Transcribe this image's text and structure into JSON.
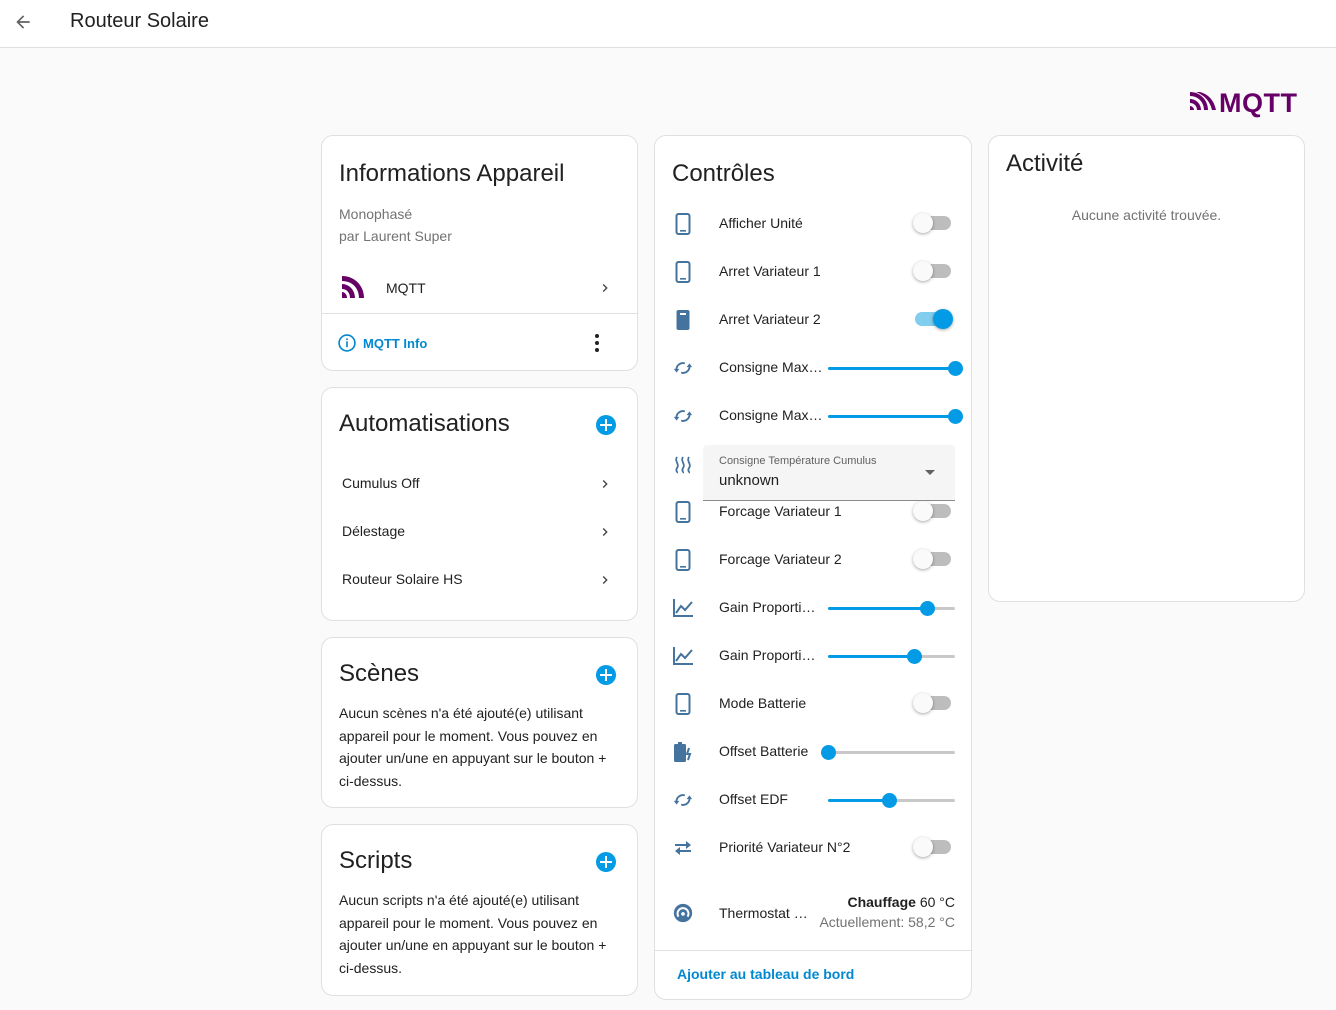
{
  "header": {
    "title": "Routeur Solaire"
  },
  "logo": {
    "text": "MQTT",
    "color": "#660066"
  },
  "device_info": {
    "title": "Informations Appareil",
    "model": "Monophasé",
    "manufacturer": "par Laurent Super",
    "integration": "MQTT",
    "info_link": "MQTT Info"
  },
  "automations": {
    "title": "Automatisations",
    "items": [
      "Cumulus Off",
      "Délestage",
      "Routeur Solaire HS"
    ]
  },
  "scenes": {
    "title": "Scènes",
    "empty_text": "Aucun scènes n'a été ajouté(e) utilisant appareil pour le moment. Vous pouvez en ajouter un/une en appuyant sur le bouton + ci-dessus."
  },
  "scripts": {
    "title": "Scripts",
    "empty_text": "Aucun scripts n'a été ajouté(e) utilisant appareil pour le moment. Vous pouvez en ajouter un/une en appuyant sur le bouton + ci-dessus."
  },
  "controls": {
    "title": "Contrôles",
    "rows": [
      {
        "label": "Afficher Unité",
        "icon": "phone-icon",
        "kind": "switch",
        "on": false
      },
      {
        "label": "Arret Variateur 1",
        "icon": "phone-icon",
        "kind": "switch",
        "on": false
      },
      {
        "label": "Arret Variateur 2",
        "icon": "phone-filled-icon",
        "kind": "switch",
        "on": true
      },
      {
        "label": "Consigne Max…",
        "icon": "rotate-icon",
        "kind": "slider",
        "value": 1.0
      },
      {
        "label": "Consigne Max…",
        "icon": "rotate-icon",
        "kind": "slider",
        "value": 1.0
      },
      {
        "label": "",
        "icon": "heat-waves-icon",
        "kind": "select"
      },
      {
        "label": "Forcage Variateur 1",
        "icon": "phone-icon",
        "kind": "switch",
        "on": false
      },
      {
        "label": "Forcage Variateur 2",
        "icon": "phone-icon",
        "kind": "switch",
        "on": false
      },
      {
        "label": "Gain Proporti…",
        "icon": "chart-line-icon",
        "kind": "slider",
        "value": 0.78
      },
      {
        "label": "Gain Proporti…",
        "icon": "chart-line-icon",
        "kind": "slider",
        "value": 0.68
      },
      {
        "label": "Mode Batterie",
        "icon": "phone-icon",
        "kind": "switch",
        "on": false
      },
      {
        "label": "Offset Batterie",
        "icon": "battery-charging-icon",
        "kind": "slider",
        "value": 0.0
      },
      {
        "label": "Offset EDF",
        "icon": "rotate-icon",
        "kind": "slider",
        "value": 0.48
      },
      {
        "label": "Priorité Variateur N°2",
        "icon": "swap-icon",
        "kind": "switch",
        "on": false
      }
    ],
    "select": {
      "label": "Consigne Température Cumulus",
      "value": "unknown"
    },
    "thermostat": {
      "label": "Thermostat …",
      "mode": "Chauffage",
      "target": "60 °C",
      "current": "Actuellement: 58,2 °C"
    },
    "footer_link": "Ajouter au tableau de bord"
  },
  "activity": {
    "title": "Activité",
    "empty_text": "Aucune activité trouvée."
  },
  "colors": {
    "accent": "#039be5",
    "link": "#0288d1",
    "icon": "#44739e"
  }
}
